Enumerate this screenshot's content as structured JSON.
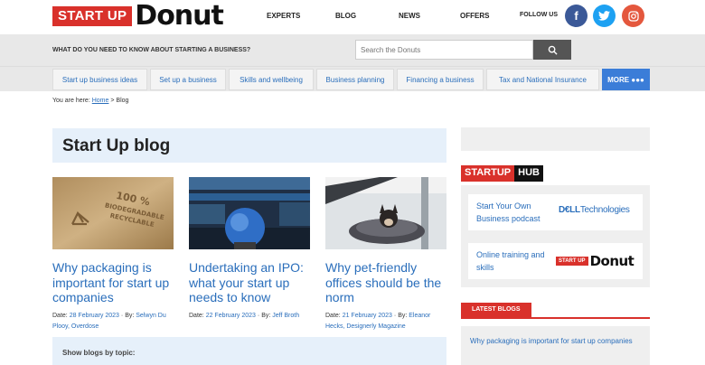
{
  "header": {
    "logo_box": "START UP",
    "logo_word": "Donut",
    "nav": [
      "EXPERTS",
      "BLOG",
      "NEWS",
      "OFFERS"
    ],
    "follow_label": "FOLLOW US",
    "social": [
      {
        "icon": "facebook-icon",
        "glyph": "f",
        "color": "#3b5998"
      },
      {
        "icon": "twitter-icon",
        "glyph": "t",
        "color": "#1da1f2"
      },
      {
        "icon": "instagram-icon",
        "glyph": "◎",
        "color": "#e4573d"
      }
    ]
  },
  "search": {
    "question": "WHAT DO YOU NEED TO KNOW ABOUT STARTING A BUSINESS?",
    "placeholder": "Search the Donuts"
  },
  "categories": [
    "Start up business ideas",
    "Set up a business",
    "Skills and wellbeing",
    "Business planning",
    "Financing a business",
    "Tax and National Insurance"
  ],
  "more_label": "MORE ●●●",
  "breadcrumb": {
    "prefix": "You are here:",
    "home": "Home",
    "sep": ">",
    "current": "Blog"
  },
  "main": {
    "title": "Start Up blog",
    "posts": [
      {
        "title": "Why packaging is important for start up companies",
        "date_label": "Date:",
        "date": "28 February 2023",
        "by_label": "By:",
        "author": "Selwyn Du Plooy, Overdose",
        "image": "recycling-box-image"
      },
      {
        "title": "Undertaking an IPO: what your start up needs to know",
        "date_label": "Date:",
        "date": "22 February 2023",
        "by_label": "By:",
        "author": "Jeff Broth",
        "image": "stock-exchange-image"
      },
      {
        "title": "Why pet-friendly offices should be the norm",
        "date_label": "Date:",
        "date": "21 February 2023",
        "by_label": "By:",
        "author": "Eleanor Hecks, Designerly Magazine",
        "image": "office-dog-image"
      }
    ],
    "topics_label": "Show blogs by topic:"
  },
  "sidebar": {
    "hub_a": "STARTUP",
    "hub_b": "HUB",
    "hub_items": [
      {
        "text": "Start Your Own Business podcast",
        "partner_a": "D€LL",
        "partner_b": "Technologies"
      },
      {
        "text": "Online training and skills",
        "partner_a": "START UP",
        "partner_b": "Donut"
      }
    ],
    "latest_label": "LATEST BLOGS",
    "latest": [
      "Why packaging is important for start up companies"
    ]
  },
  "colors": {
    "brand_red": "#d9312b",
    "link_blue": "#2a6ebb",
    "more_blue": "#3b7dd8"
  }
}
